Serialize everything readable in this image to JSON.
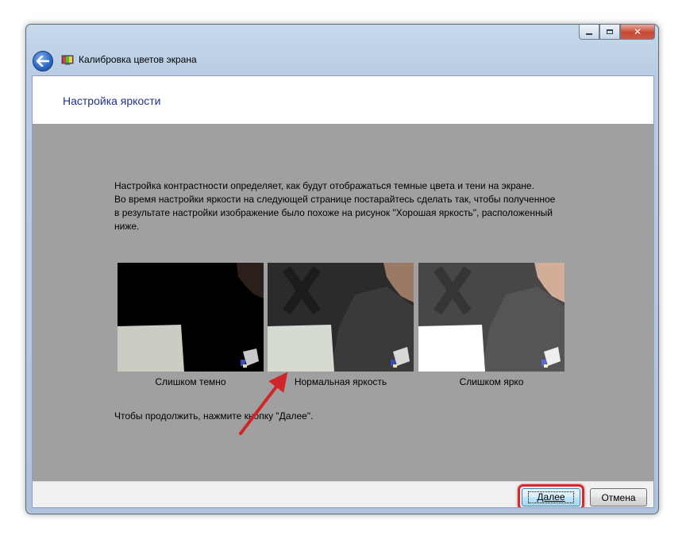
{
  "window": {
    "title": "Калибровка цветов экрана",
    "caption_buttons": [
      "minimize",
      "maximize",
      "close"
    ]
  },
  "page": {
    "title": "Настройка яркости",
    "description": [
      "Настройка контрастности определяет, как будут отображаться темные цвета и тени на экране.",
      "Во время настройки яркости на следующей странице постарайтесь сделать так, чтобы полученное в результате настройки изображение было похоже на рисунок \"Хорошая яркость\", расположенный ниже."
    ],
    "samples": [
      {
        "label": "Слишком темно",
        "brightness": "dark"
      },
      {
        "label": "Нормальная яркость",
        "brightness": "normal"
      },
      {
        "label": "Слишком ярко",
        "brightness": "bright"
      }
    ],
    "continue_text": "Чтобы продолжить, нажмите кнопку \"Далее\"."
  },
  "footer": {
    "next_label": "Далее",
    "cancel_label": "Отмена"
  },
  "annotations": {
    "arrow_color": "#d0262a",
    "highlight_color": "#d22a2a"
  },
  "icons": {
    "back": "back-arrow-icon",
    "app": "monitor-color-icon"
  }
}
